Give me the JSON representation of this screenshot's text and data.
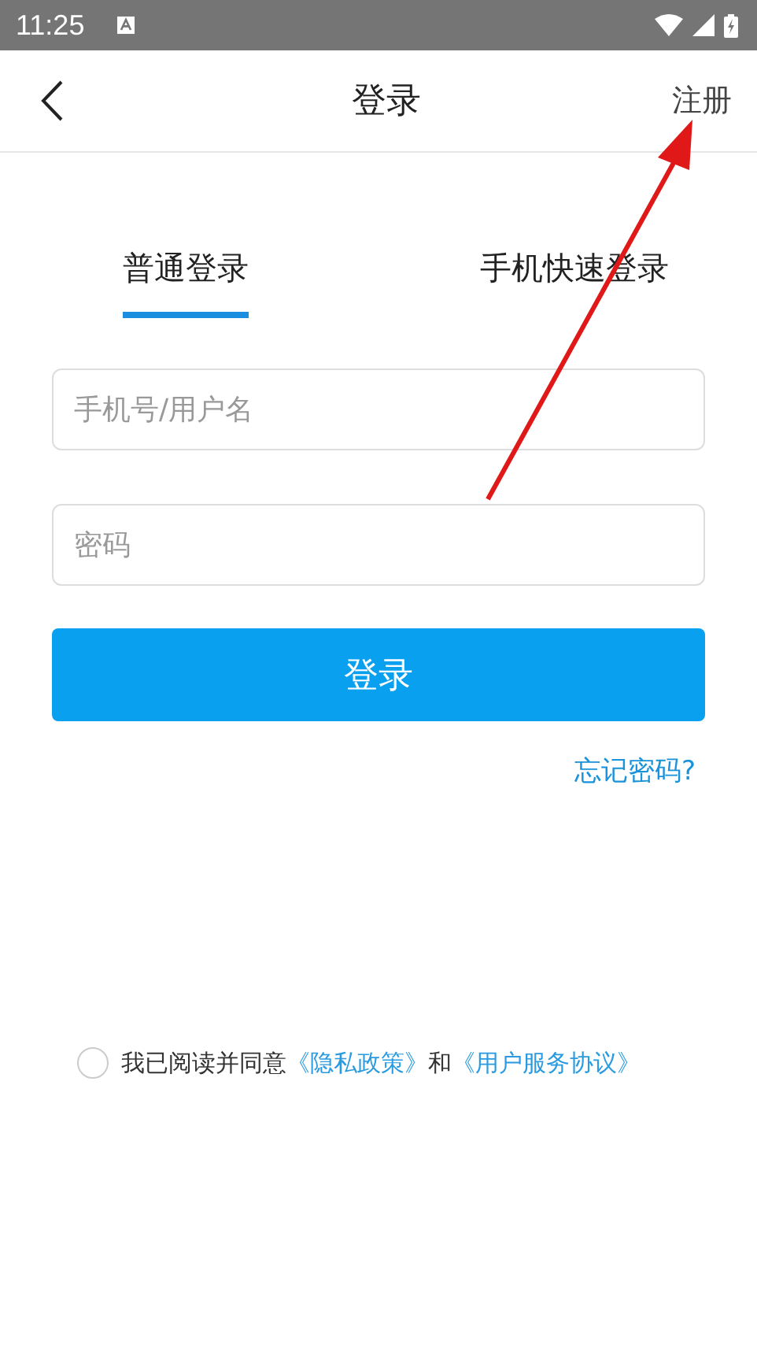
{
  "status_bar": {
    "time": "11:25"
  },
  "nav_bar": {
    "title": "登录",
    "action": "注册"
  },
  "tabs": [
    {
      "label": "普通登录",
      "selected": true
    },
    {
      "label": "手机快速登录",
      "selected": false
    }
  ],
  "username_field": {
    "placeholder": "手机号/用户名"
  },
  "password_field": {
    "placeholder": "密码"
  },
  "login_button": "登录",
  "forgot_link": "忘记密码?",
  "agreement": {
    "checked": false,
    "text": "我已阅读并同意",
    "privacy_link": "《隐私政策》",
    "and": "和",
    "terms_link": "《用户服务协议》"
  },
  "annotation": {
    "kind": "arrow"
  }
}
